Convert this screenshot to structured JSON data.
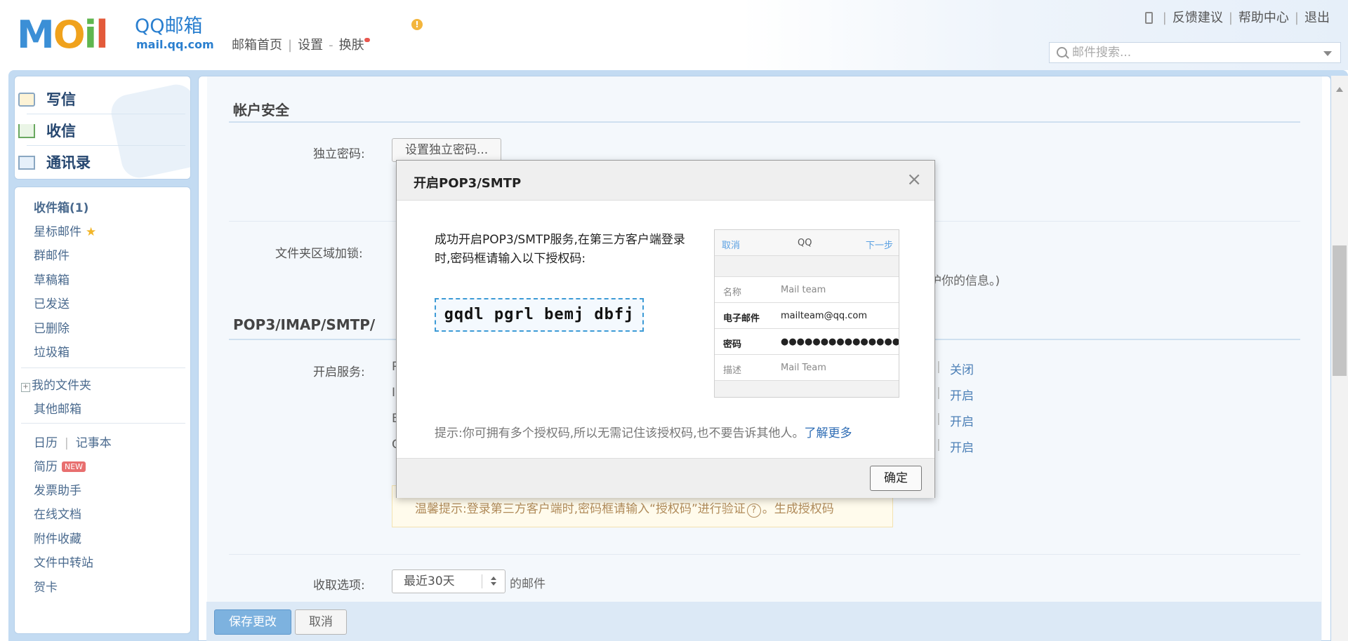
{
  "header": {
    "logo_text": "MOil",
    "logo_name": "QQ邮箱",
    "logo_url": "mail.qq.com",
    "nav": [
      "邮箱首页",
      "设置",
      "换肤"
    ],
    "links": [
      "反馈建议",
      "帮助中心",
      "退出"
    ],
    "search_placeholder": "邮件搜索..."
  },
  "quick": [
    "写信",
    "收信",
    "通讯录"
  ],
  "sidebar": {
    "folders": [
      "收件箱(1)",
      "星标邮件",
      "群邮件",
      "草稿箱",
      "已发送",
      "已删除",
      "垃圾箱"
    ],
    "my_folders": "我的文件夹",
    "other_mailbox": "其他邮箱",
    "calendar": "日历",
    "notepad": "记事本",
    "resume": "简历",
    "new_badge": "NEW",
    "tools": [
      "发票助手",
      "在线文档",
      "附件收藏",
      "文件中转站",
      "贺卡"
    ]
  },
  "main": {
    "section1_title": "帐户安全",
    "label_password": "独立密码:",
    "btn_set_password": "设置独立密码...",
    "label_folder_lock": "文件夹区域加锁:",
    "folder_lock_tail": "护你的信息。)",
    "section2_title": "POP3/IMAP/SMTP/",
    "label_service": "开启服务:",
    "service_actions": [
      "关闭",
      "开启",
      "开启",
      "开启"
    ],
    "service_letters": [
      "P",
      "I",
      "E",
      "C"
    ],
    "hint_prefix": "温馨提示:登录第三方客户端时,密码框请输入“授权码”进行验证",
    "hint_q": "?",
    "hint_link": "。生成授权码",
    "label_fetch": "收取选项:",
    "fetch_value": "最近30天",
    "fetch_suffix": "的邮件",
    "btn_save": "保存更改",
    "btn_cancel": "取消"
  },
  "dialog": {
    "title": "开启POP3/SMTP",
    "close": "×",
    "message": "成功开启POP3/SMTP服务,在第三方客户端登录时,密码框请输入以下授权码:",
    "code": "gqdl pgrl bemj dbfj",
    "phone": {
      "cancel": "取消",
      "title": "QQ",
      "next": "下一步",
      "rows": [
        {
          "k": "名称",
          "v": "Mail team"
        },
        {
          "k": "电子邮件",
          "v": "mailteam@qq.com"
        },
        {
          "k": "密码",
          "v": "●●●●●●●●●●●●●●●●"
        },
        {
          "k": "描述",
          "v": "Mail Team"
        }
      ]
    },
    "tip": "提示:你可拥有多个授权码,所以无需记住该授权码,也不要告诉其他人。",
    "tip_link": "了解更多",
    "ok": "确定"
  },
  "colors": {
    "accent": "#3b8fd6",
    "frame": "#c3dbf2",
    "code_border": "#3d9bd6",
    "primary_button": "#7db2df"
  }
}
